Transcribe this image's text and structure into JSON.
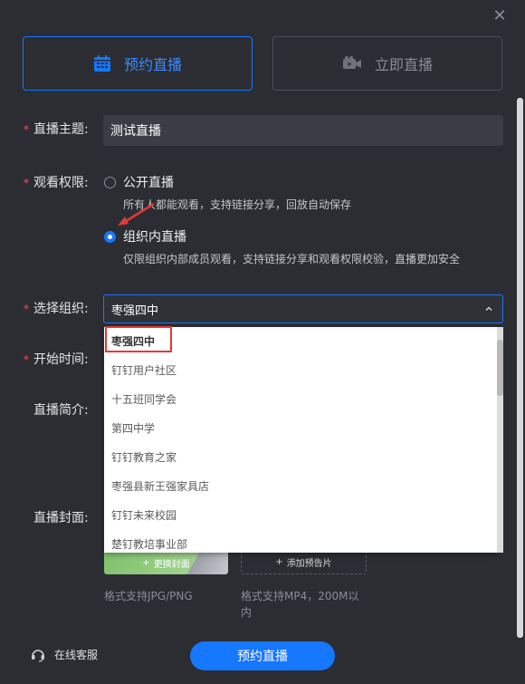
{
  "dialog": {
    "close_label": "✕"
  },
  "tabs": [
    {
      "label": "预约直播",
      "icon": "calendar-icon",
      "active": true
    },
    {
      "label": "立即直播",
      "icon": "video-camera-icon",
      "active": false
    }
  ],
  "form": {
    "topic": {
      "required_mark": "*",
      "label": "直播主题:",
      "value": "测试直播"
    },
    "permission": {
      "required_mark": "*",
      "label": "观看权限:",
      "options": [
        {
          "title": "公开直播",
          "desc": "所有人都能观看，支持链接分享，回放自动保存",
          "selected": false
        },
        {
          "title": "组织内直播",
          "desc": "仅限组织内部成员观看，支持链接分享和观看权限校验，直播更加安全",
          "selected": true
        }
      ]
    },
    "org": {
      "required_mark": "*",
      "label": "选择组织:",
      "value": "枣强四中",
      "options": [
        "枣强四中",
        "钉钉用户社区",
        "十五班同学会",
        "第四中学",
        "钉钉教育之家",
        "枣强县新王强家具店",
        "钉钉未来校园",
        "楚钉教培事业部"
      ]
    },
    "start_time": {
      "required_mark": "*",
      "label": "开始时间:"
    },
    "intro": {
      "label": "直播简介:"
    },
    "cover": {
      "label": "直播封面:",
      "change_cover_label": "更换封面",
      "add_trailer_label": "添加预告片",
      "cover_hint": "格式支持JPG/PNG",
      "trailer_hint": "格式支持MP4，200M以内"
    }
  },
  "footer": {
    "support_label": "在线客服",
    "submit_label": "预约直播"
  },
  "colors": {
    "accent": "#1677ff",
    "background": "#2b2d33",
    "required": "#ff4d4f",
    "highlight": "#e53935"
  }
}
